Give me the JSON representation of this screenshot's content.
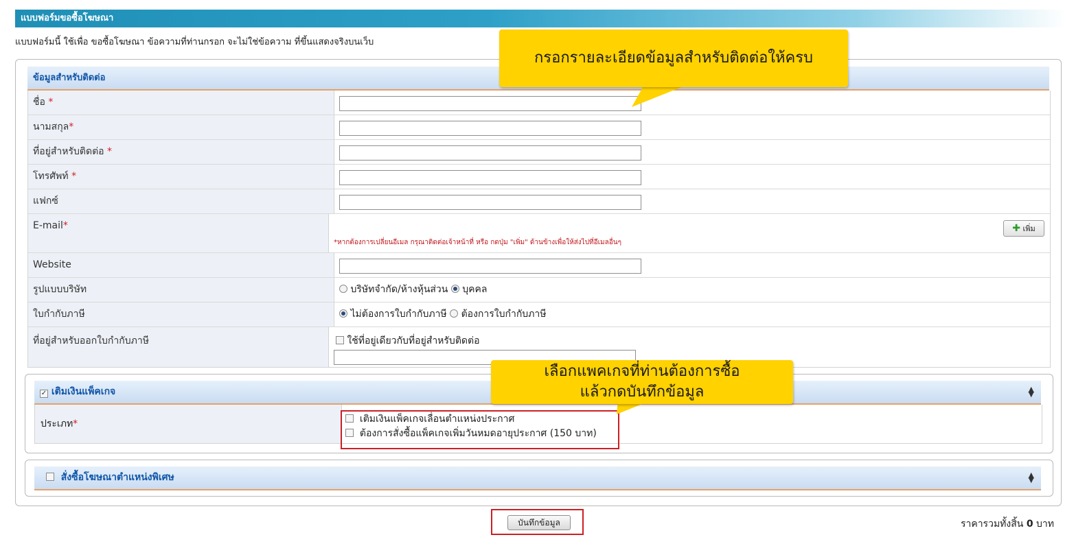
{
  "title": "แบบฟอร์มขอซื้อโฆษณา",
  "description": "แบบฟอร์มนี้ ใช้เพื่อ ขอซื้อโฆษณา ข้อความที่ท่านกรอก จะไม่ใช่ข้อความ ที่ขึ้นแสดงจริงบนเว็บ",
  "contact_section": {
    "heading": "ข้อมูลสำหรับติดต่อ",
    "required_mark": "*",
    "fields": {
      "first_name": {
        "label": "ชื่อ ",
        "value": ""
      },
      "last_name": {
        "label": "นามสกุล",
        "value": ""
      },
      "address": {
        "label": "ที่อยู่สำหรับติดต่อ ",
        "value": ""
      },
      "phone": {
        "label": "โทรศัพท์ ",
        "value": ""
      },
      "fax": {
        "label": "แฟกซ์",
        "value": ""
      },
      "email": {
        "label": "E-mail",
        "note": "*หากต้องการเปลี่ยนอีเมล กรุณาติดต่อเจ้าหน้าที่ หรือ กดปุ่ม \"เพิ่ม\" ด้านข้างเพื่อให้ส่งไปที่อีเมลอื่นๆ",
        "add_button": "เพิ่ม"
      },
      "website": {
        "label": "Website",
        "value": ""
      },
      "company_type": {
        "label": "รูปแบบบริษัท",
        "options": [
          "บริษัทจำกัด/ห้างหุ้นส่วน",
          "บุคคล"
        ],
        "selected": "บุคคล"
      },
      "tax_invoice": {
        "label": "ใบกำกับภาษี",
        "options": [
          "ไม่ต้องการใบกำกับภาษี",
          "ต้องการใบกำกับภาษี"
        ],
        "selected": "ไม่ต้องการใบกำกับภาษี"
      },
      "invoice_address": {
        "label": "ที่อยู่สำหรับออกใบกำกับภาษี",
        "same_as_contact": "ใช้ที่อยู่เดียวกับที่อยู่สำหรับติดต่อ",
        "value": ""
      }
    }
  },
  "package_section": {
    "heading": "เติมเงินแพ็คเกจ",
    "checked": true,
    "type_label": "ประเภท",
    "options": [
      "เติมเงินแพ็คเกจเลื่อนตำแหน่งประกาศ",
      "ต้องการสั่งซื้อแพ็คเกจเพิ่มวันหมดอายุประกาศ (150 บาท)"
    ]
  },
  "special_section": {
    "heading": "สั่งซื้อโฆษณาตำแหน่งพิเศษ",
    "checked": false
  },
  "callouts": {
    "top": "กรอกรายละเอียดข้อมูลสำหรับติดต่อให้ครบ",
    "middle_line1": "เลือกแพคเกจที่ท่านต้องการซื้อ",
    "middle_line2": "แล้วกดบันทึกข้อมูล"
  },
  "save_button": "บันทึกข้อมูล",
  "total": {
    "label": "ราคารวมทั้งสิ้น",
    "amount": "0",
    "unit": "บาท"
  },
  "colors": {
    "title_bar": "#1f8fb6",
    "section_heading": "#1256a8",
    "required": "#d0212a",
    "callout": "#ffd200",
    "highlight_box": "#cc1f24"
  }
}
